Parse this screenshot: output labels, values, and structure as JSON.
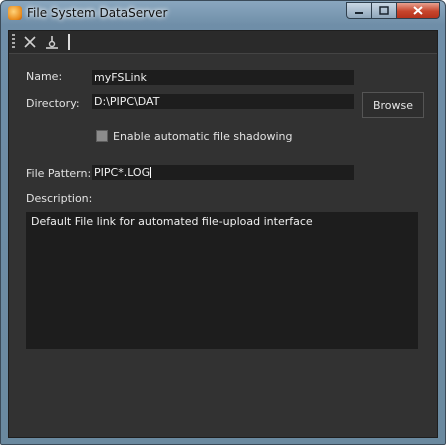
{
  "window": {
    "title": "File System DataServer",
    "icon": "dataserver-app-icon"
  },
  "titlebar_buttons": {
    "minimize_icon": "minimize-icon",
    "maximize_icon": "maximize-icon",
    "close_icon": "close-icon"
  },
  "toolbar": {
    "icons": [
      "delete-x-icon",
      "disconnect-icon"
    ]
  },
  "form": {
    "name": {
      "label": "Name:",
      "value": "myFSLink"
    },
    "directory": {
      "label": "Directory:",
      "value": "D:\\PIPC\\DAT",
      "browse_label": "Browse"
    },
    "shadowing": {
      "label": "Enable automatic file shadowing",
      "checked": false
    },
    "file_pattern": {
      "label": "File Pattern:",
      "value": "PIPC*.LOG"
    },
    "description": {
      "label": "Description:",
      "value": "Default File link for automated file-upload interface"
    }
  }
}
